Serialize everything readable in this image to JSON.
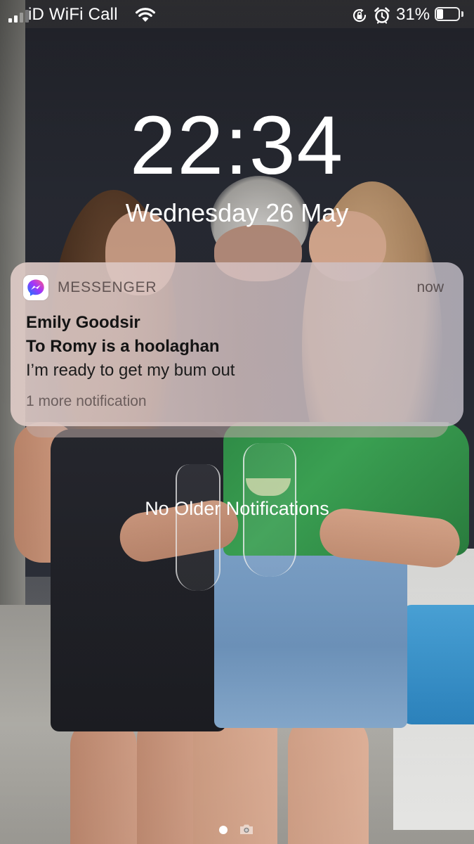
{
  "status_bar": {
    "carrier": "iD WiFi Call",
    "battery_percent": "31%",
    "battery_level": 0.31,
    "icons": [
      "signal-icon",
      "wifi-icon",
      "rotation-lock-icon",
      "alarm-icon",
      "battery-icon"
    ]
  },
  "lock_screen": {
    "time": "22:34",
    "date": "Wednesday 26 May"
  },
  "notification": {
    "app_name": "MESSENGER",
    "timestamp": "now",
    "sender": "Emily Goodsir",
    "conversation": "To Romy is a hoolaghan",
    "message": "I’m ready to get my bum out",
    "more": "1 more notification",
    "app_icon": "messenger-icon",
    "accent_color": "#7b4dff"
  },
  "no_older": "No Older Notifications",
  "bottom": {
    "icons": [
      "page-dot-icon",
      "camera-icon"
    ]
  }
}
